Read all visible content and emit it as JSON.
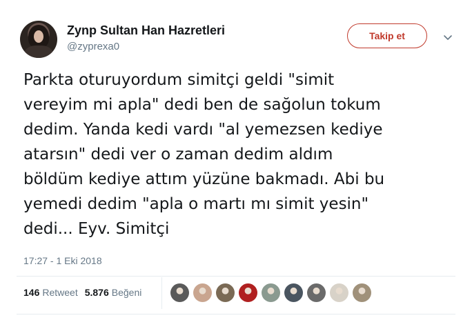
{
  "author": {
    "display_name": "Zynp Sultan Han Hazretleri",
    "handle": "@zyprexa0",
    "avatar_icon": "profile-photo"
  },
  "follow_button": {
    "label": "Takip et",
    "accent_color": "#c0392b"
  },
  "menu_icon": "chevron-down-icon",
  "tweet": {
    "lines": [
      "Parkta oturuyordum simitçi geldi \"simit",
      "vereyim mi apla\" dedi ben de sağolun tokum",
      "dedim. Yanda kedi vardı \"al yemezsen kediye",
      "atarsın\" dedi ver o zaman dedim aldım",
      "böldüm kediye attım yüzüne bakmadı. Abi bu",
      "yemedi dedim \"apla o martı mı simit yesin\"",
      "dedi... Eyv. Simitçi"
    ],
    "timestamp": "17:27 - 1 Eki 2018"
  },
  "stats": {
    "retweets_count": "146",
    "retweets_label": "Retweet",
    "likes_count": "5.876",
    "likes_label": "Beğeni"
  },
  "likers": [
    {
      "color": "#5a5a5a"
    },
    {
      "color": "#c9a58f"
    },
    {
      "color": "#7a6a55"
    },
    {
      "color": "#b02020"
    },
    {
      "color": "#8a9a90"
    },
    {
      "color": "#4a5560"
    },
    {
      "color": "#6a6a6a"
    },
    {
      "color": "#d8d2c8"
    },
    {
      "color": "#a0917a"
    }
  ]
}
